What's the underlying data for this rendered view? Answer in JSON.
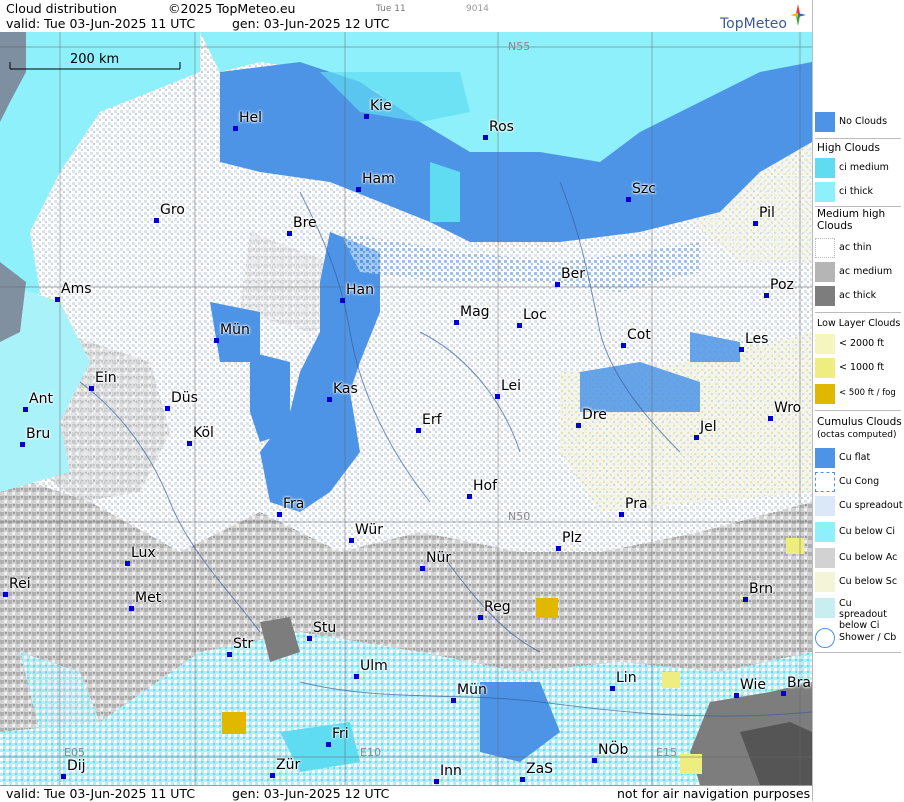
{
  "header": {
    "title": "Cloud distribution",
    "copyright": "©2025 TopMeteo.eu",
    "small1": "Tue 11",
    "small2": "9014",
    "valid": "valid:  Tue  03-Jun-2025  11 UTC",
    "gen": "gen: 03-Jun-2025 12 UTC",
    "logo": "TopMeteo"
  },
  "footer": {
    "valid": "valid:  Tue  03-Jun-2025  11 UTC",
    "gen": "gen: 03-Jun-2025 12 UTC",
    "note": "not for air navigation purposes"
  },
  "map": {
    "scale": "200 km",
    "grid_labels": [
      "N55",
      "N50",
      "E05",
      "E10",
      "E15"
    ],
    "cities": [
      "Hel",
      "Kie",
      "Ros",
      "Ham",
      "Szc",
      "Gro",
      "Bre",
      "Pil",
      "Ams",
      "Han",
      "Ber",
      "Mag",
      "Loc",
      "Poz",
      "Mün",
      "Cot",
      "Les",
      "Ein",
      "Kas",
      "Lei",
      "Ant",
      "Düs",
      "Dre",
      "Wro",
      "Bru",
      "Köl",
      "Erf",
      "Jel",
      "Hof",
      "Fra",
      "Pra",
      "Lux",
      "Wür",
      "Plz",
      "Rei",
      "Nür",
      "Met",
      "Reg",
      "Brn",
      "Stu",
      "Str",
      "Ulm",
      "Lin",
      "Wie",
      "Bra",
      "Mün",
      "Fri",
      "Zür",
      "NÖb",
      "Dij",
      "Inn",
      "ZaS"
    ]
  },
  "legend": {
    "no_clouds": "No Clouds",
    "high_title": "High Clouds",
    "ci_medium": "ci medium",
    "ci_thick": "ci thick",
    "medium_title": "Medium high Clouds",
    "ac_thin": "ac thin",
    "ac_medium": "ac medium",
    "ac_thick": "ac thick",
    "low_title": "Low Layer Clouds",
    "low_2000": "< 2000 ft",
    "low_1000": "< 1000 ft",
    "low_500": "< 500 ft / fog",
    "cu_title": "Cumulus Clouds",
    "cu_sub": "(octas computed)",
    "cu_flat": "Cu flat",
    "cu_cong": "Cu Cong",
    "cu_spread": "Cu spreadout",
    "cu_below_ci": "Cu below Ci",
    "cu_below_ac": "Cu below Ac",
    "cu_below_sc": "Cu below Sc",
    "cu_spread_ci": "Cu spreadout below Ci",
    "shower": "Shower / Cb"
  },
  "colors": {
    "no_clouds": "#4d94e6",
    "ci_medium": "#5fdcf2",
    "ci_thick": "#8ef0fa",
    "ac_thin": "#ffffff",
    "ac_medium": "#b5b5b5",
    "ac_thick": "#7d7d7d",
    "low_2000": "#f5f5c0",
    "low_1000": "#eeee80",
    "fog": "#e0b800"
  }
}
